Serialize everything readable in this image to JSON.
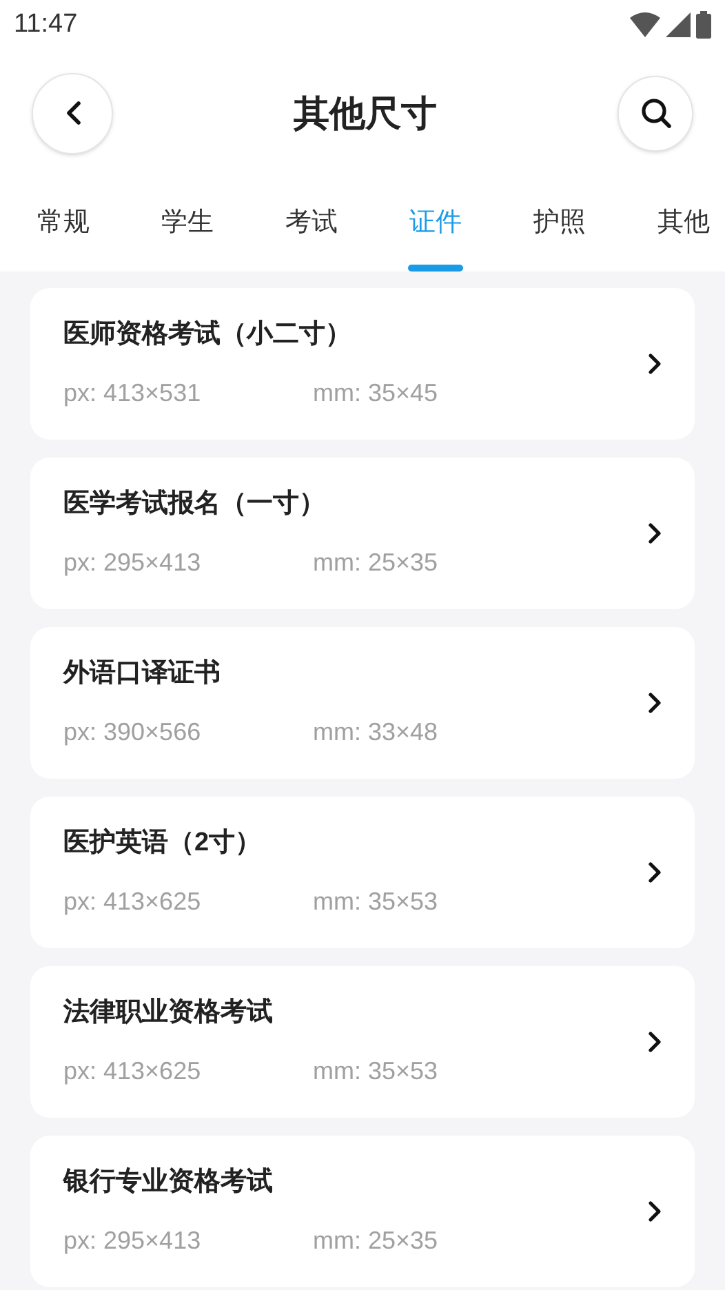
{
  "status_bar": {
    "time": "11:47"
  },
  "header": {
    "title": "其他尺寸"
  },
  "tabs": [
    {
      "label": "常规",
      "selected": false
    },
    {
      "label": "学生",
      "selected": false
    },
    {
      "label": "考试",
      "selected": false
    },
    {
      "label": "证件",
      "selected": true
    },
    {
      "label": "护照",
      "selected": false
    },
    {
      "label": "其他",
      "selected": false
    }
  ],
  "items": [
    {
      "title": "医师资格考试（小二寸）",
      "px": "px: 413×531",
      "mm": "mm: 35×45"
    },
    {
      "title": "医学考试报名（一寸）",
      "px": "px: 295×413",
      "mm": "mm: 25×35"
    },
    {
      "title": "外语口译证书",
      "px": "px: 390×566",
      "mm": "mm: 33×48"
    },
    {
      "title": "医护英语（2寸）",
      "px": "px: 413×625",
      "mm": "mm: 35×53"
    },
    {
      "title": "法律职业资格考试",
      "px": "px: 413×625",
      "mm": "mm: 35×53"
    },
    {
      "title": "银行专业资格考试",
      "px": "px: 295×413",
      "mm": "mm: 25×35"
    }
  ]
}
